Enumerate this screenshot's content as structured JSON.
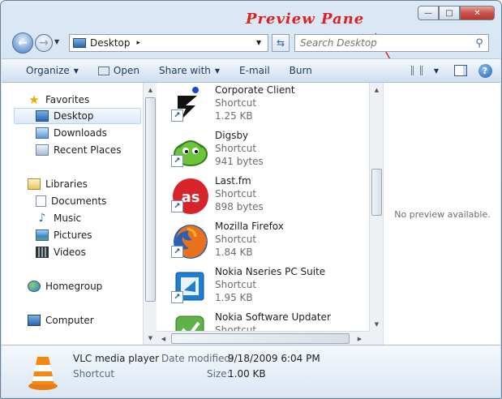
{
  "window": {
    "caption_min": "—",
    "caption_max": "□",
    "caption_close": "✕"
  },
  "annotation": {
    "text": "Preview Pane",
    "color": "#e02020"
  },
  "address_bar": {
    "location": "Desktop",
    "chevron": "▸"
  },
  "search": {
    "placeholder": "Search Desktop"
  },
  "toolbar": {
    "organize": "Organize",
    "open": "Open",
    "share_with": "Share with",
    "email": "E-mail",
    "burn": "Burn",
    "help": "?"
  },
  "nav": {
    "favorites": "Favorites",
    "desktop": "Desktop",
    "downloads": "Downloads",
    "recent_places": "Recent Places",
    "libraries": "Libraries",
    "documents": "Documents",
    "music": "Music",
    "pictures": "Pictures",
    "videos": "Videos",
    "homegroup": "Homegroup",
    "computer": "Computer"
  },
  "files": [
    {
      "name": "Corporate Client",
      "type": "Shortcut",
      "size": "1.25 KB",
      "icon": "corporate-client-icon"
    },
    {
      "name": "Digsby",
      "type": "Shortcut",
      "size": "941 bytes",
      "icon": "digsby-icon"
    },
    {
      "name": "Last.fm",
      "type": "Shortcut",
      "size": "898 bytes",
      "icon": "lastfm-icon"
    },
    {
      "name": "Mozilla Firefox",
      "type": "Shortcut",
      "size": "1.84 KB",
      "icon": "firefox-icon"
    },
    {
      "name": "Nokia Nseries PC Suite",
      "type": "Shortcut",
      "size": "1.95 KB",
      "icon": "nokia-pc-suite-icon"
    },
    {
      "name": "Nokia Software Updater",
      "type": "Shortcut",
      "size": "",
      "icon": "nokia-updater-icon"
    }
  ],
  "preview": {
    "message": "No preview available."
  },
  "details": {
    "name": "VLC media player",
    "type": "Shortcut",
    "date_label": "Date modified:",
    "date_value": "9/18/2009 6:04 PM",
    "size_label": "Size:",
    "size_value": "1.00 KB"
  },
  "colors": {
    "accent": "#3f78c4",
    "annotation": "#e02020",
    "selection": "#dbeaf8"
  }
}
